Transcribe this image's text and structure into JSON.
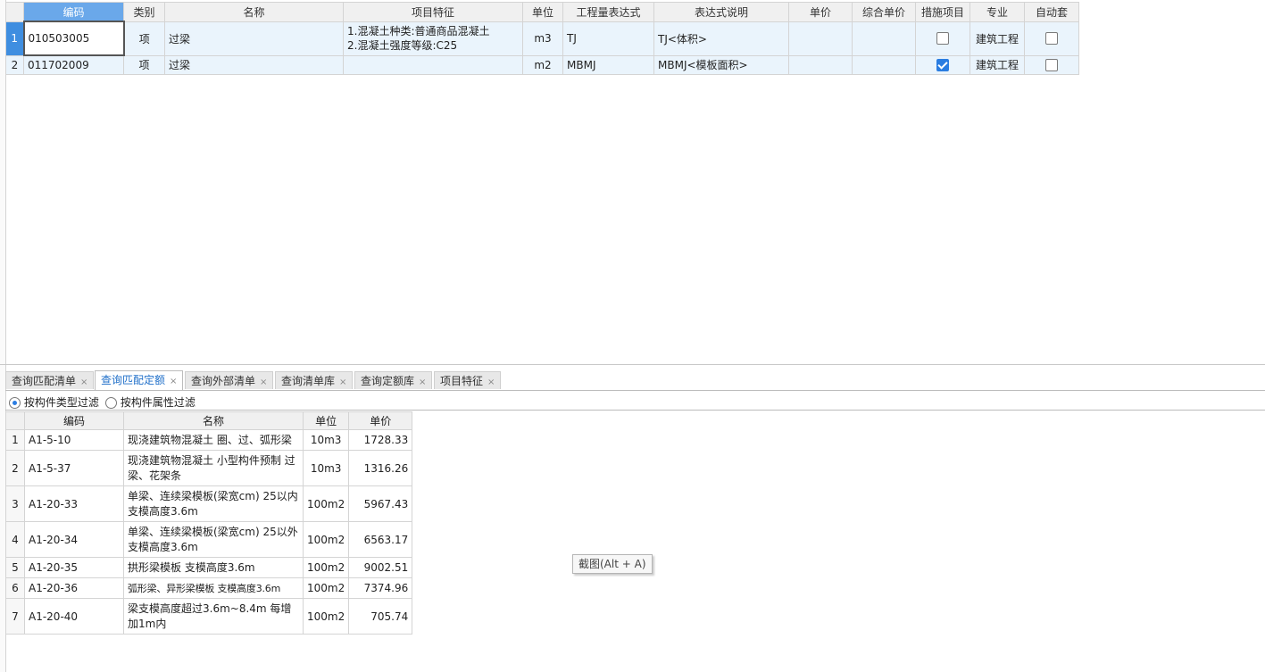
{
  "top_grid": {
    "headers": [
      "编码",
      "类别",
      "名称",
      "项目特征",
      "单位",
      "工程量表达式",
      "表达式说明",
      "单价",
      "综合单价",
      "措施项目",
      "专业",
      "自动套"
    ],
    "rows": [
      {
        "no": "1",
        "code": "010503005",
        "type": "项",
        "name": "过梁",
        "feature_line1": "1.混凝土种类:普通商品混凝土",
        "feature_line2": "2.混凝土强度等级:C25",
        "unit": "m3",
        "expr": "TJ",
        "expr_desc": "TJ<体积>",
        "price": "",
        "total_price": "",
        "measure": false,
        "major": "建筑工程",
        "auto": false
      },
      {
        "no": "2",
        "code": "011702009",
        "type": "项",
        "name": "过梁",
        "feature_line1": "",
        "feature_line2": "",
        "unit": "m2",
        "expr": "MBMJ",
        "expr_desc": "MBMJ<模板面积>",
        "price": "",
        "total_price": "",
        "measure": true,
        "major": "建筑工程",
        "auto": false
      }
    ]
  },
  "tabs": [
    {
      "label": "查询匹配清单",
      "active": false
    },
    {
      "label": "查询匹配定额",
      "active": true
    },
    {
      "label": "查询外部清单",
      "active": false
    },
    {
      "label": "查询清单库",
      "active": false
    },
    {
      "label": "查询定额库",
      "active": false
    },
    {
      "label": "项目特征",
      "active": false
    }
  ],
  "tab_close_glyph": "×",
  "filter": {
    "option1": "按构件类型过滤",
    "option2": "按构件属性过滤",
    "selected": "option1"
  },
  "bottom_grid": {
    "headers": [
      "编码",
      "名称",
      "单位",
      "单价"
    ],
    "rows": [
      {
        "no": "1",
        "code": "A1-5-10",
        "name": "现浇建筑物混凝土 圈、过、弧形梁",
        "unit": "10m3",
        "price": "1728.33"
      },
      {
        "no": "2",
        "code": "A1-5-37",
        "name": "现浇建筑物混凝土 小型构件预制 过梁、花架条",
        "unit": "10m3",
        "price": "1316.26"
      },
      {
        "no": "3",
        "code": "A1-20-33",
        "name": "单梁、连续梁模板(梁宽cm) 25以内 支模高度3.6m",
        "unit": "100m2",
        "price": "5967.43"
      },
      {
        "no": "4",
        "code": "A1-20-34",
        "name": "单梁、连续梁模板(梁宽cm) 25以外 支模高度3.6m",
        "unit": "100m2",
        "price": "6563.17"
      },
      {
        "no": "5",
        "code": "A1-20-35",
        "name": "拱形梁模板 支模高度3.6m",
        "unit": "100m2",
        "price": "9002.51"
      },
      {
        "no": "6",
        "code": "A1-20-36",
        "name": "弧形梁、异形梁模板 支模高度3.6m",
        "unit": "100m2",
        "price": "7374.96"
      },
      {
        "no": "7",
        "code": "A1-20-40",
        "name": "梁支模高度超过3.6m~8.4m 每增加1m内",
        "unit": "100m2",
        "price": "705.74"
      }
    ]
  },
  "tooltip": "截图(Alt + A)"
}
